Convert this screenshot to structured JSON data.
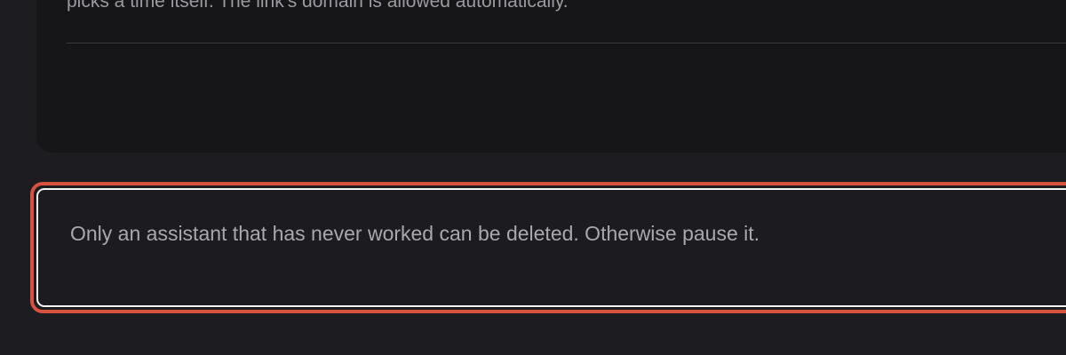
{
  "top_card": {
    "description_tail": "picks a time itself. The link's domain is allowed automatically."
  },
  "notice": {
    "text": "Only an assistant that has never worked can be deleted. Otherwise pause it."
  },
  "colors": {
    "background": "#1d1c21",
    "card": "#161518",
    "highlight_border": "#d9523f",
    "highlight_inner": "#f7f5f4"
  }
}
